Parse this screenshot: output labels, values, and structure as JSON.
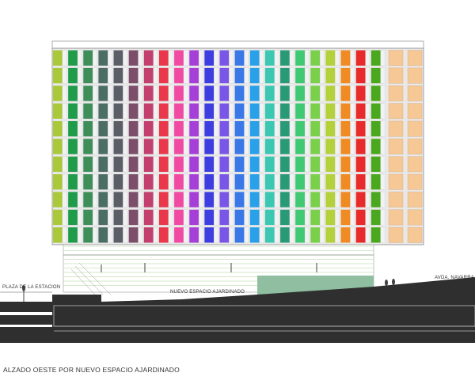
{
  "drawing": {
    "caption": "ALZADO OESTE POR NUEVO ESPACIO AJARDINADO",
    "labels": {
      "plaza": "PLAZA DE LA ESTACION",
      "garden": "NUEVO ESPACIO AJARDINADO",
      "avenue": "AVDA. NAVARRA"
    }
  },
  "facade": {
    "floors": 11,
    "columns": 22,
    "tower_floors": 11,
    "column_colors": [
      "#a9c83a",
      "#1f9b4a",
      "#3e8e5a",
      "#4a6e63",
      "#5b5e66",
      "#7c4e6a",
      "#c2406e",
      "#e8384a",
      "#f04aa3",
      "#a63ed8",
      "#3e3ee0",
      "#7a56e6",
      "#3a78e8",
      "#2aa0e8",
      "#3ac8b2",
      "#2a9a76",
      "#40c872",
      "#7ad04a",
      "#b4d03a",
      "#f08a22",
      "#e82a2a",
      "#4aa81e"
    ],
    "tower_color": "#f5c896",
    "stripe_color": "#c9e0b8",
    "garden_color": "#8fbfa0",
    "ground_color": "#2f2f2f"
  }
}
